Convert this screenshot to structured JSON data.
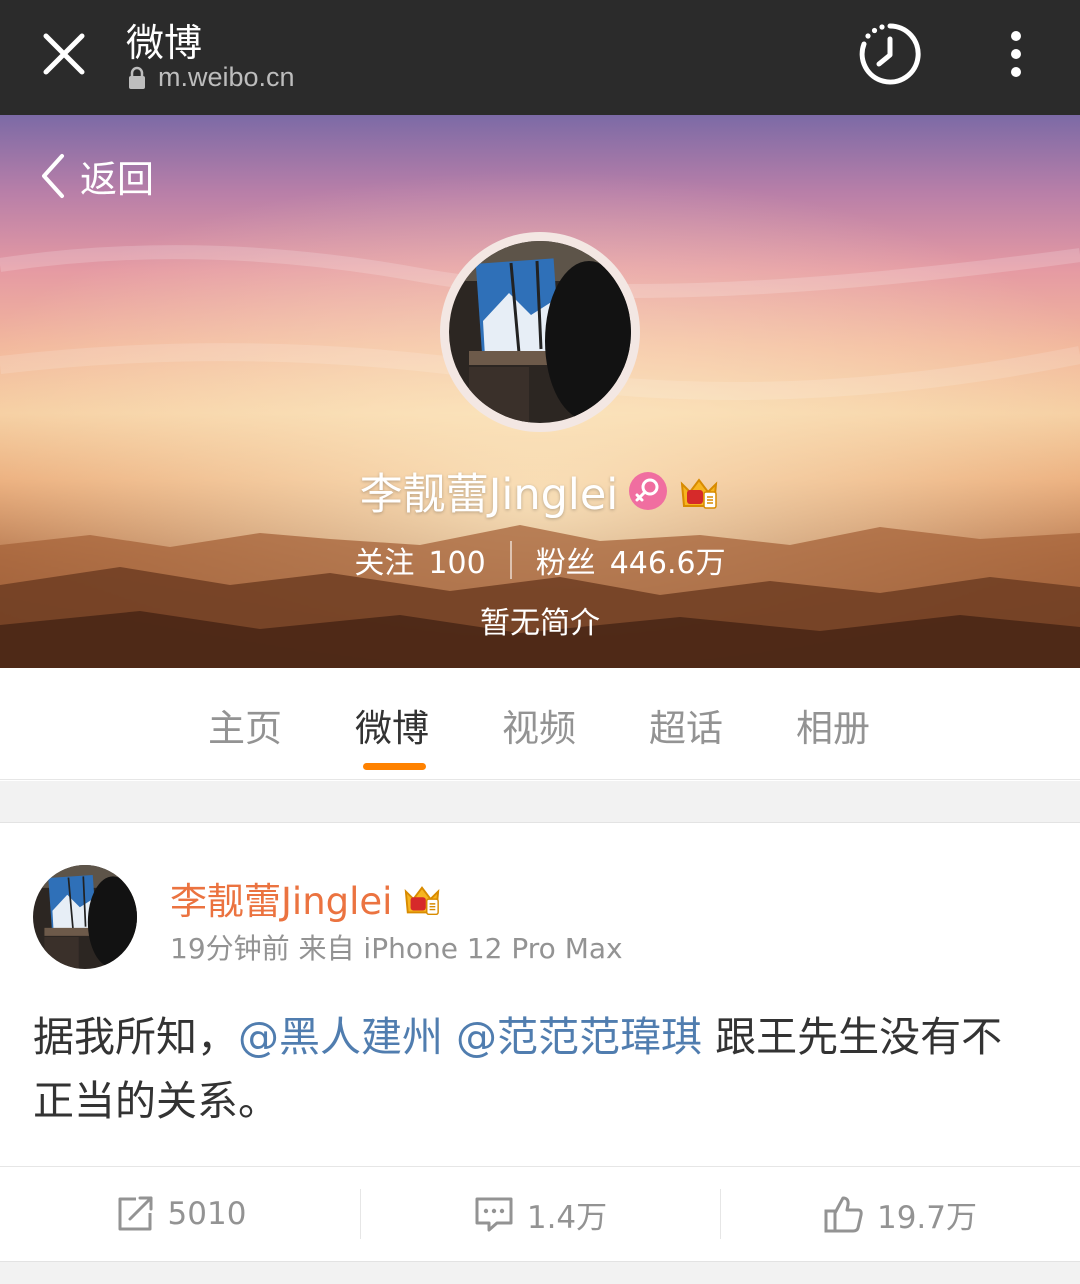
{
  "browser": {
    "title": "微博",
    "url": "m.weibo.cn"
  },
  "profile": {
    "back_label": "返回",
    "name": "李靓蕾Jinglei",
    "following_label": "关注",
    "following_count": "100",
    "followers_label": "粉丝",
    "followers_count": "446.6万",
    "bio": "暂无简介"
  },
  "tabs": [
    {
      "label": "主页"
    },
    {
      "label": "微博",
      "active": true
    },
    {
      "label": "视频"
    },
    {
      "label": "超话"
    },
    {
      "label": "相册"
    }
  ],
  "post": {
    "author": "李靓蕾Jinglei",
    "meta": "19分钟前 来自 iPhone 12 Pro Max",
    "text_before": "据我所知，",
    "mention_1": "@黑人建州",
    "mention_2": "@范范范瑋琪",
    "text_after": "跟王先生没有不正当的关系。",
    "reposts": "5010",
    "comments": "1.4万",
    "likes": "19.7万"
  },
  "colors": {
    "topbar": "#2b2b2b",
    "accent_orange": "#ff8200",
    "author_orange": "#eb7340",
    "mention_blue": "#507daf",
    "female_badge": "#f06ea0"
  },
  "icons": [
    "close-icon",
    "lock-icon",
    "history-icon",
    "more-icon",
    "chevron-left-icon",
    "female-icon",
    "vip-crown-icon",
    "repost-icon",
    "comment-icon",
    "like-icon"
  ]
}
